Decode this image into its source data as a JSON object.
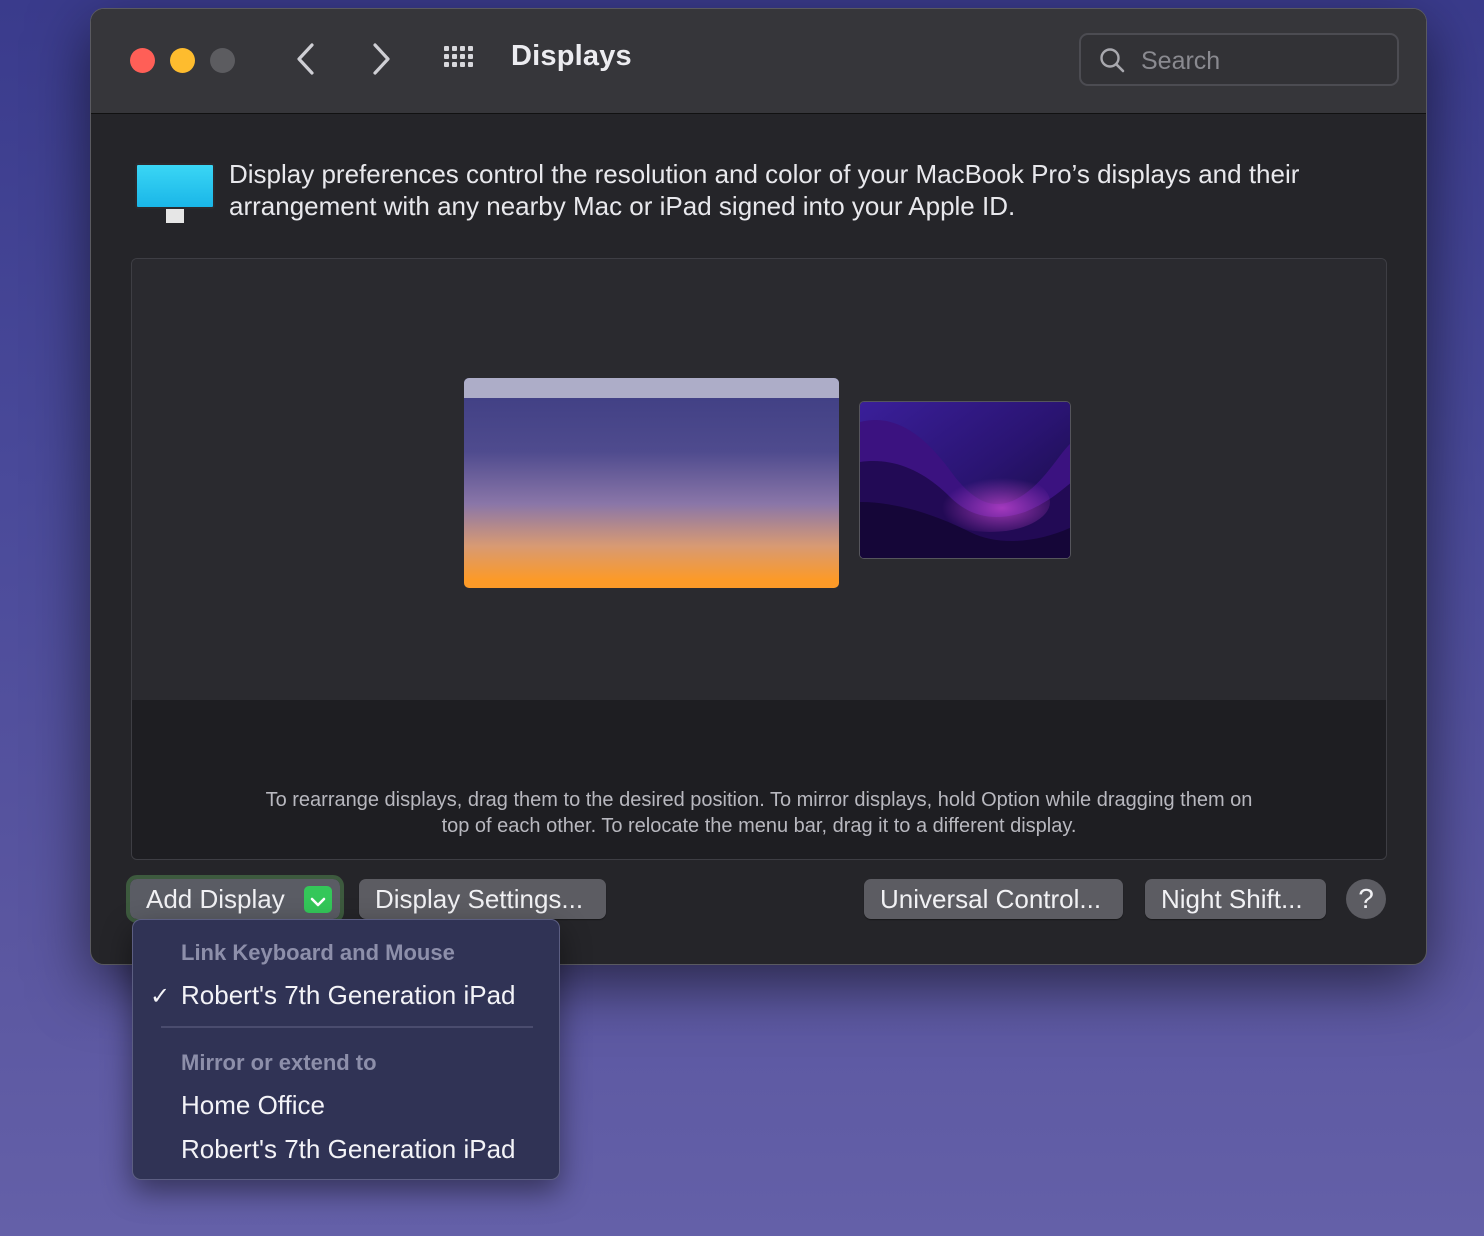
{
  "window": {
    "title": "Displays",
    "search_placeholder": "Search"
  },
  "description": "Display preferences control the resolution and color of your MacBook Pro’s displays and their arrangement with any nearby Mac or iPad signed into your Apple ID.",
  "arrangement": {
    "hint": "To rearrange displays, drag them to the desired position. To mirror displays, hold Option while dragging them on top of each other. To relocate the menu bar, drag it to a different display."
  },
  "buttons": {
    "add_display": "Add Display",
    "display_settings": "Display Settings...",
    "universal_control": "Universal Control...",
    "night_shift": "Night Shift...",
    "help": "?"
  },
  "dropdown": {
    "link_header": "Link Keyboard and Mouse",
    "link_items": [
      {
        "label": "Robert's 7th Generation iPad",
        "checked": true,
        "check_glyph": "✓"
      }
    ],
    "mirror_header": "Mirror or extend to",
    "mirror_items": [
      {
        "label": "Home Office"
      },
      {
        "label": "Robert's 7th Generation iPad"
      }
    ]
  },
  "icons": {
    "close": "close-icon",
    "minimize": "minimize-icon",
    "zoom": "zoom-icon",
    "back": "chevron-left-icon",
    "forward": "chevron-right-icon",
    "grid": "grid-icon",
    "search": "search-icon",
    "display": "monitor-icon",
    "dropdown_arrow": "chevron-down-icon"
  },
  "colors": {
    "accent_green": "#34c759",
    "close_red": "#ff5f57",
    "minimize_yellow": "#febc2e"
  }
}
